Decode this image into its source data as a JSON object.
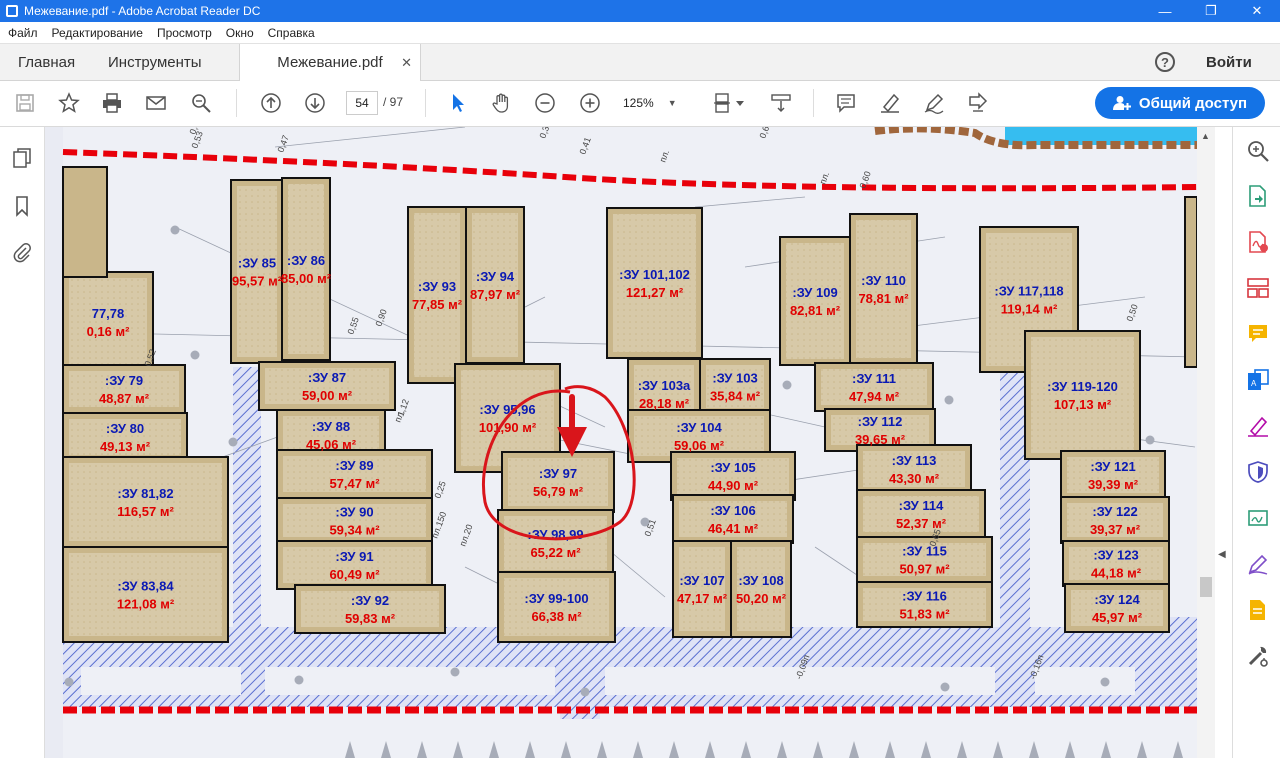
{
  "window": {
    "title": "Межевание.pdf - Adobe Acrobat Reader DC"
  },
  "menu": {
    "items": [
      "Файл",
      "Редактирование",
      "Просмотр",
      "Окно",
      "Справка"
    ]
  },
  "tabs": {
    "home": "Главная",
    "tools": "Инструменты",
    "document": "Межевание.pdf"
  },
  "header": {
    "help": "?",
    "login": "Войти"
  },
  "toolbar": {
    "page_current": "54",
    "page_total": "/ 97",
    "zoom": "125%",
    "share": "Общий доступ"
  },
  "colors": {
    "titlebar": "#1e73e8",
    "share_button": "#1473e6",
    "lot_fill": "#c9b68a",
    "lot_label": "#0a19b4",
    "lot_area": "#e00000",
    "boundary_red": "#e8000a",
    "road_hatch": "#5a6fd0"
  },
  "plan": {
    "lots": [
      {
        "label": ":ЗУ 85",
        "area": "95,57 м²"
      },
      {
        "label": ":ЗУ 86",
        "area": "85,00 м²"
      },
      {
        "label": ":ЗУ 93",
        "area": "77,85 м²"
      },
      {
        "label": ":ЗУ 94",
        "area": "87,97 м²"
      },
      {
        "label": ":ЗУ 101,102",
        "area": "121,27 м²"
      },
      {
        "label": ":ЗУ 109",
        "area": "82,81 м²"
      },
      {
        "label": ":ЗУ 110",
        "area": "78,81 м²"
      },
      {
        "label": ":ЗУ 117,118",
        "area": "119,14 м²"
      },
      {
        "label": "77,78",
        "area": "0,16 м²"
      },
      {
        "label": ":ЗУ 79",
        "area": "48,87 м²"
      },
      {
        "label": ":ЗУ 80",
        "area": "49,13 м²"
      },
      {
        "label": ":ЗУ 81,82",
        "area": "116,57 м²"
      },
      {
        "label": ":ЗУ 83,84",
        "area": "121,08 м²"
      },
      {
        "label": ":ЗУ 87",
        "area": "59,00 м²"
      },
      {
        "label": ":ЗУ 88",
        "area": "45,06 м²"
      },
      {
        "label": ":ЗУ 89",
        "area": "57,47 м²"
      },
      {
        "label": ":ЗУ 90",
        "area": "59,34 м²"
      },
      {
        "label": ":ЗУ 91",
        "area": "60,49 м²"
      },
      {
        "label": ":ЗУ 92",
        "area": "59,83 м²"
      },
      {
        "label": ":ЗУ 95,96",
        "area": "101,90 м²"
      },
      {
        "label": ":ЗУ 97",
        "area": "56,79 м²"
      },
      {
        "label": ":ЗУ 98,99",
        "area": "65,22 м²"
      },
      {
        "label": ":ЗУ 99-100",
        "area": "66,38 м²"
      },
      {
        "label": ":ЗУ 103а",
        "area": "28,18 м²"
      },
      {
        "label": ":ЗУ 103",
        "area": "35,84 м²"
      },
      {
        "label": ":ЗУ 104",
        "area": "59,06 м²"
      },
      {
        "label": ":ЗУ 105",
        "area": "44,90 м²"
      },
      {
        "label": ":ЗУ 106",
        "area": "46,41 м²"
      },
      {
        "label": ":ЗУ 107",
        "area": "47,17 м²"
      },
      {
        "label": ":ЗУ 108",
        "area": "50,20 м²"
      },
      {
        "label": ":ЗУ 111",
        "area": "47,94 м²"
      },
      {
        "label": ":ЗУ 112",
        "area": "39,65 м²"
      },
      {
        "label": ":ЗУ 113",
        "area": "43,30 м²"
      },
      {
        "label": ":ЗУ 114",
        "area": "52,37 м²"
      },
      {
        "label": ":ЗУ 115",
        "area": "50,97 м²"
      },
      {
        "label": ":ЗУ 116",
        "area": "51,83 м²"
      },
      {
        "label": ":ЗУ 119-120",
        "area": "107,13 м²"
      },
      {
        "label": ":ЗУ 121",
        "area": "39,39 м²"
      },
      {
        "label": ":ЗУ 122",
        "area": "39,37 м²"
      },
      {
        "label": ":ЗУ 123",
        "area": "44,18 м²"
      },
      {
        "label": ":ЗУ 124",
        "area": "45,97 м²"
      }
    ],
    "small_labels": [
      "0,45",
      "0,53",
      "0,47",
      "0,39",
      "0,41",
      "пл.",
      "0,63",
      "пл.",
      "0,60",
      "0,52",
      "0,55",
      "0,90",
      "пл.",
      "1,12",
      "0,25",
      "пл.150",
      "пл.20",
      "-0,09п",
      "-0,16п",
      "0,65",
      "0,51",
      "0,50"
    ]
  }
}
